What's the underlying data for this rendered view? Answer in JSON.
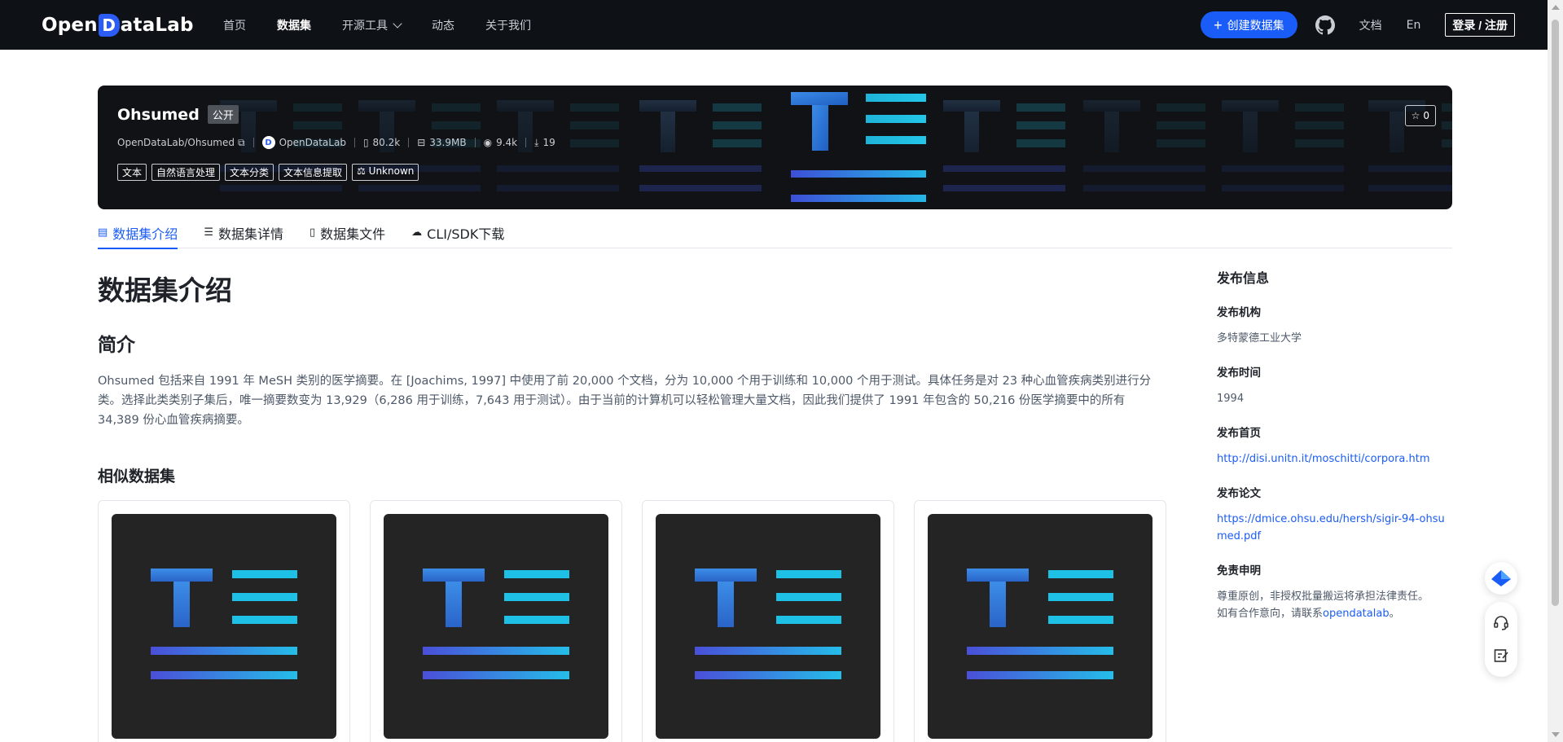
{
  "nav": {
    "logo_prefix": "Open",
    "logo_d": "D",
    "logo_suffix": "ataLab",
    "links": [
      "首页",
      "数据集",
      "开源工具",
      "动态",
      "关于我们"
    ],
    "active_link": "数据集",
    "create_button": "创建数据集",
    "docs": "文档",
    "lang": "En",
    "login": "登录 / 注册"
  },
  "banner": {
    "title": "Ohsumed",
    "visibility": "公开",
    "path": "OpenDataLab/Ohsumed",
    "org": "OpenDataLab",
    "files": "80.2k",
    "size": "33.9MB",
    "views": "9.4k",
    "downloads": "19",
    "tags": [
      "文本",
      "自然语言处理",
      "文本分类",
      "文本信息提取"
    ],
    "license": "Unknown",
    "stars": "0"
  },
  "tabs": [
    "数据集介绍",
    "数据集详情",
    "数据集文件",
    "CLI/SDK下载"
  ],
  "content": {
    "heading": "数据集介绍",
    "intro_heading": "简介",
    "intro_text": "Ohsumed 包括来自 1991 年 MeSH 类别的医学摘要。在 [Joachims, 1997] 中使用了前 20,000 个文档，分为 10,000 个用于训练和 10,000 个用于测试。具体任务是对 23 种心血管疾病类别进行分类。选择此类类别子集后，唯一摘要数变为 13,929（6,286 用于训练，7,643 用于测试）。由于当前的计算机可以轻松管理大量文档，因此我们提供了 1991 年包含的 50,216 份医学摘要中的所有 34,389 份心血管疾病摘要。",
    "similar_heading": "相似数据集"
  },
  "sidebar": {
    "title": "发布信息",
    "org_label": "发布机构",
    "org_value": "多特蒙德工业大学",
    "time_label": "发布时间",
    "time_value": "1994",
    "home_label": "发布首页",
    "home_value": "http://disi.unitn.it/moschitti/corpora.htm",
    "paper_label": "发布论文",
    "paper_value": "https://dmice.ohsu.edu/hersh/sigir-94-ohsumed.pdf",
    "disclaimer_label": "免责申明",
    "disclaimer_text_1": "尊重原创，非授权批量搬运将承担法律责任。",
    "disclaimer_text_2": "如有合作意向，请联系",
    "disclaimer_link": "opendatalab",
    "disclaimer_end": "。"
  },
  "colors": {
    "nav_bg": "#0e1116",
    "accent": "#1a5cf7",
    "banner_bg": "#101215",
    "card_thumb_bg": "#242424"
  }
}
